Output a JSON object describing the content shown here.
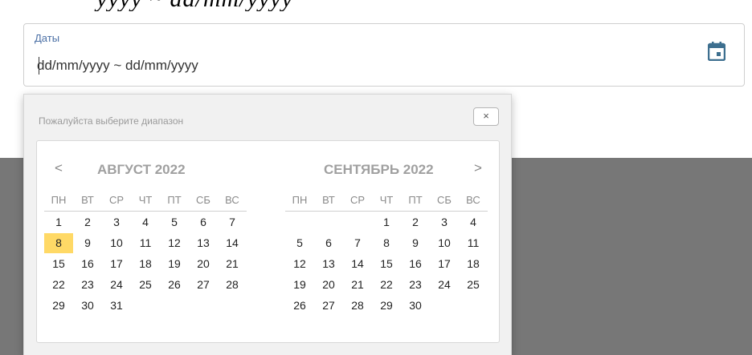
{
  "header_partial": "yyyy ~ dd/mm/yyyy",
  "field": {
    "label": "Даты",
    "value": "dd/mm/yyyy ~ dd/mm/yyyy",
    "icon": "calendar-icon"
  },
  "picker": {
    "title": "Пожалуйста выберите диапазон",
    "close_label": "×",
    "prev_label": "<",
    "next_label": ">",
    "weekdays": [
      "ПН",
      "ВТ",
      "СР",
      "ЧТ",
      "ПТ",
      "СБ",
      "ВС"
    ],
    "months": [
      {
        "title": "АВГУСТ 2022",
        "days": [
          "1",
          "2",
          "3",
          "4",
          "5",
          "6",
          "7",
          "8",
          "9",
          "10",
          "11",
          "12",
          "13",
          "14",
          "15",
          "16",
          "17",
          "18",
          "19",
          "20",
          "21",
          "22",
          "23",
          "24",
          "25",
          "26",
          "27",
          "28",
          "29",
          "30",
          "31"
        ],
        "leading_blanks": 0,
        "highlighted_day": "8"
      },
      {
        "title": "СЕНТЯБРЬ 2022",
        "days": [
          "1",
          "2",
          "3",
          "4",
          "5",
          "6",
          "7",
          "8",
          "9",
          "10",
          "11",
          "12",
          "13",
          "14",
          "15",
          "16",
          "17",
          "18",
          "19",
          "20",
          "21",
          "22",
          "23",
          "24",
          "25",
          "26",
          "27",
          "28",
          "29",
          "30"
        ],
        "leading_blanks": 3,
        "highlighted_day": ""
      }
    ],
    "highlight_color": "#ffd966"
  }
}
